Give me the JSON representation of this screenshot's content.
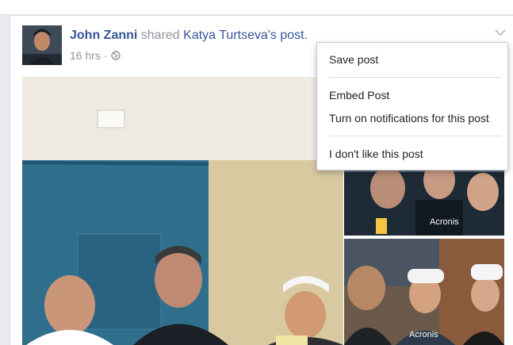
{
  "post": {
    "author": "John Zanni",
    "verb": "shared",
    "target": "Katya Turtseva's post.",
    "time": "16 hrs",
    "separator": "·"
  },
  "menu": {
    "items": [
      "Save post",
      "Embed Post",
      "Turn on notifications for this post",
      "I don't like this post"
    ]
  },
  "photos": {
    "badge_text": "Acronis"
  },
  "colors": {
    "link": "#365899",
    "muted": "#90949c",
    "menu_text": "#1d2129"
  }
}
